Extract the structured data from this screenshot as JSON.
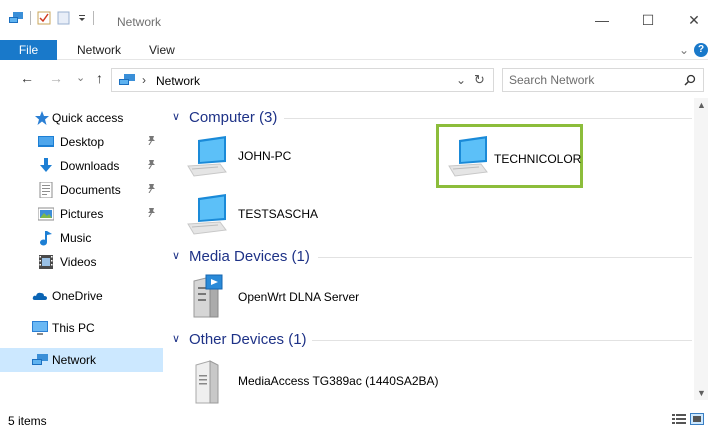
{
  "window": {
    "title": "Network",
    "minimize": "—",
    "maximize": "☐",
    "close": "✕"
  },
  "ribbon": {
    "tabs": [
      "File",
      "Network",
      "View"
    ],
    "expand": "⌄",
    "help": "?"
  },
  "nav": {
    "back": "←",
    "forward": "→",
    "recent": "⌄",
    "up": "↑",
    "breadcrumb_sep": "›",
    "location": "Network",
    "dropdown": "⌄",
    "refresh": "↻",
    "search_placeholder": "Search Network"
  },
  "sidebar": {
    "items": [
      {
        "label": "Quick access",
        "icon": "star-icon"
      },
      {
        "label": "Desktop",
        "icon": "desktop-folder-icon",
        "pinned": true
      },
      {
        "label": "Downloads",
        "icon": "downloads-folder-icon",
        "pinned": true
      },
      {
        "label": "Documents",
        "icon": "documents-folder-icon",
        "pinned": true
      },
      {
        "label": "Pictures",
        "icon": "pictures-folder-icon",
        "pinned": true
      },
      {
        "label": "Music",
        "icon": "music-folder-icon"
      },
      {
        "label": "Videos",
        "icon": "videos-folder-icon"
      },
      {
        "label": "OneDrive",
        "icon": "onedrive-cloud-icon"
      },
      {
        "label": "This PC",
        "icon": "this-pc-icon"
      },
      {
        "label": "Network",
        "icon": "network-icon",
        "selected": true
      }
    ],
    "pin_glyph": "📌"
  },
  "groups": [
    {
      "title": "Computer (3)",
      "items": [
        {
          "label": "JOHN-PC",
          "icon": "computer-icon"
        },
        {
          "label": "TECHNICOLOR",
          "icon": "computer-icon",
          "highlighted": true
        },
        {
          "label": "TESTSASCHA",
          "icon": "computer-icon"
        }
      ]
    },
    {
      "title": "Media Devices (1)",
      "items": [
        {
          "label": "OpenWrt DLNA Server",
          "icon": "media-server-icon"
        }
      ]
    },
    {
      "title": "Other Devices (1)",
      "items": [
        {
          "label": "MediaAccess TG389ac (1440SA2BA)",
          "icon": "router-device-icon"
        }
      ]
    }
  ],
  "group_chevron": "∨",
  "status": {
    "items_count": "5 items"
  },
  "colors": {
    "accent": "#1979ca",
    "group_header": "#1e3287",
    "selection": "#cce8ff",
    "highlight_border": "#8cbd3b"
  }
}
